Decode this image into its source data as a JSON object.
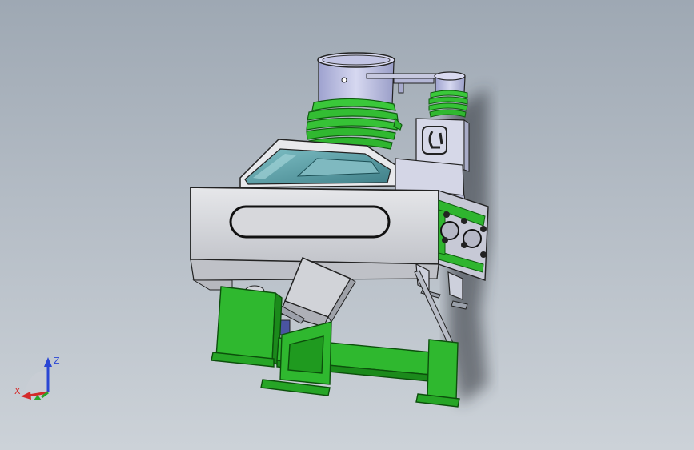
{
  "viewport": {
    "background_top": "#9ea8b3",
    "background_bottom": "#ccd2d8"
  },
  "model": {
    "part_colors": {
      "housing": "#cfd1d6",
      "housing_light": "#e4e5e8",
      "housing_dark": "#a8abb3",
      "frame": "#2fb82f",
      "frame_dark": "#1b8a1b",
      "bellows": "#33c033",
      "cylinder": "#b9bce0",
      "glass": "#5f9fa8",
      "outline": "#222222"
    }
  },
  "triad": {
    "x_label": "X",
    "y_label": "",
    "z_label": "Z",
    "x_color": "#d42a2a",
    "y_color": "#2aa52a",
    "z_color": "#2a46d4"
  }
}
